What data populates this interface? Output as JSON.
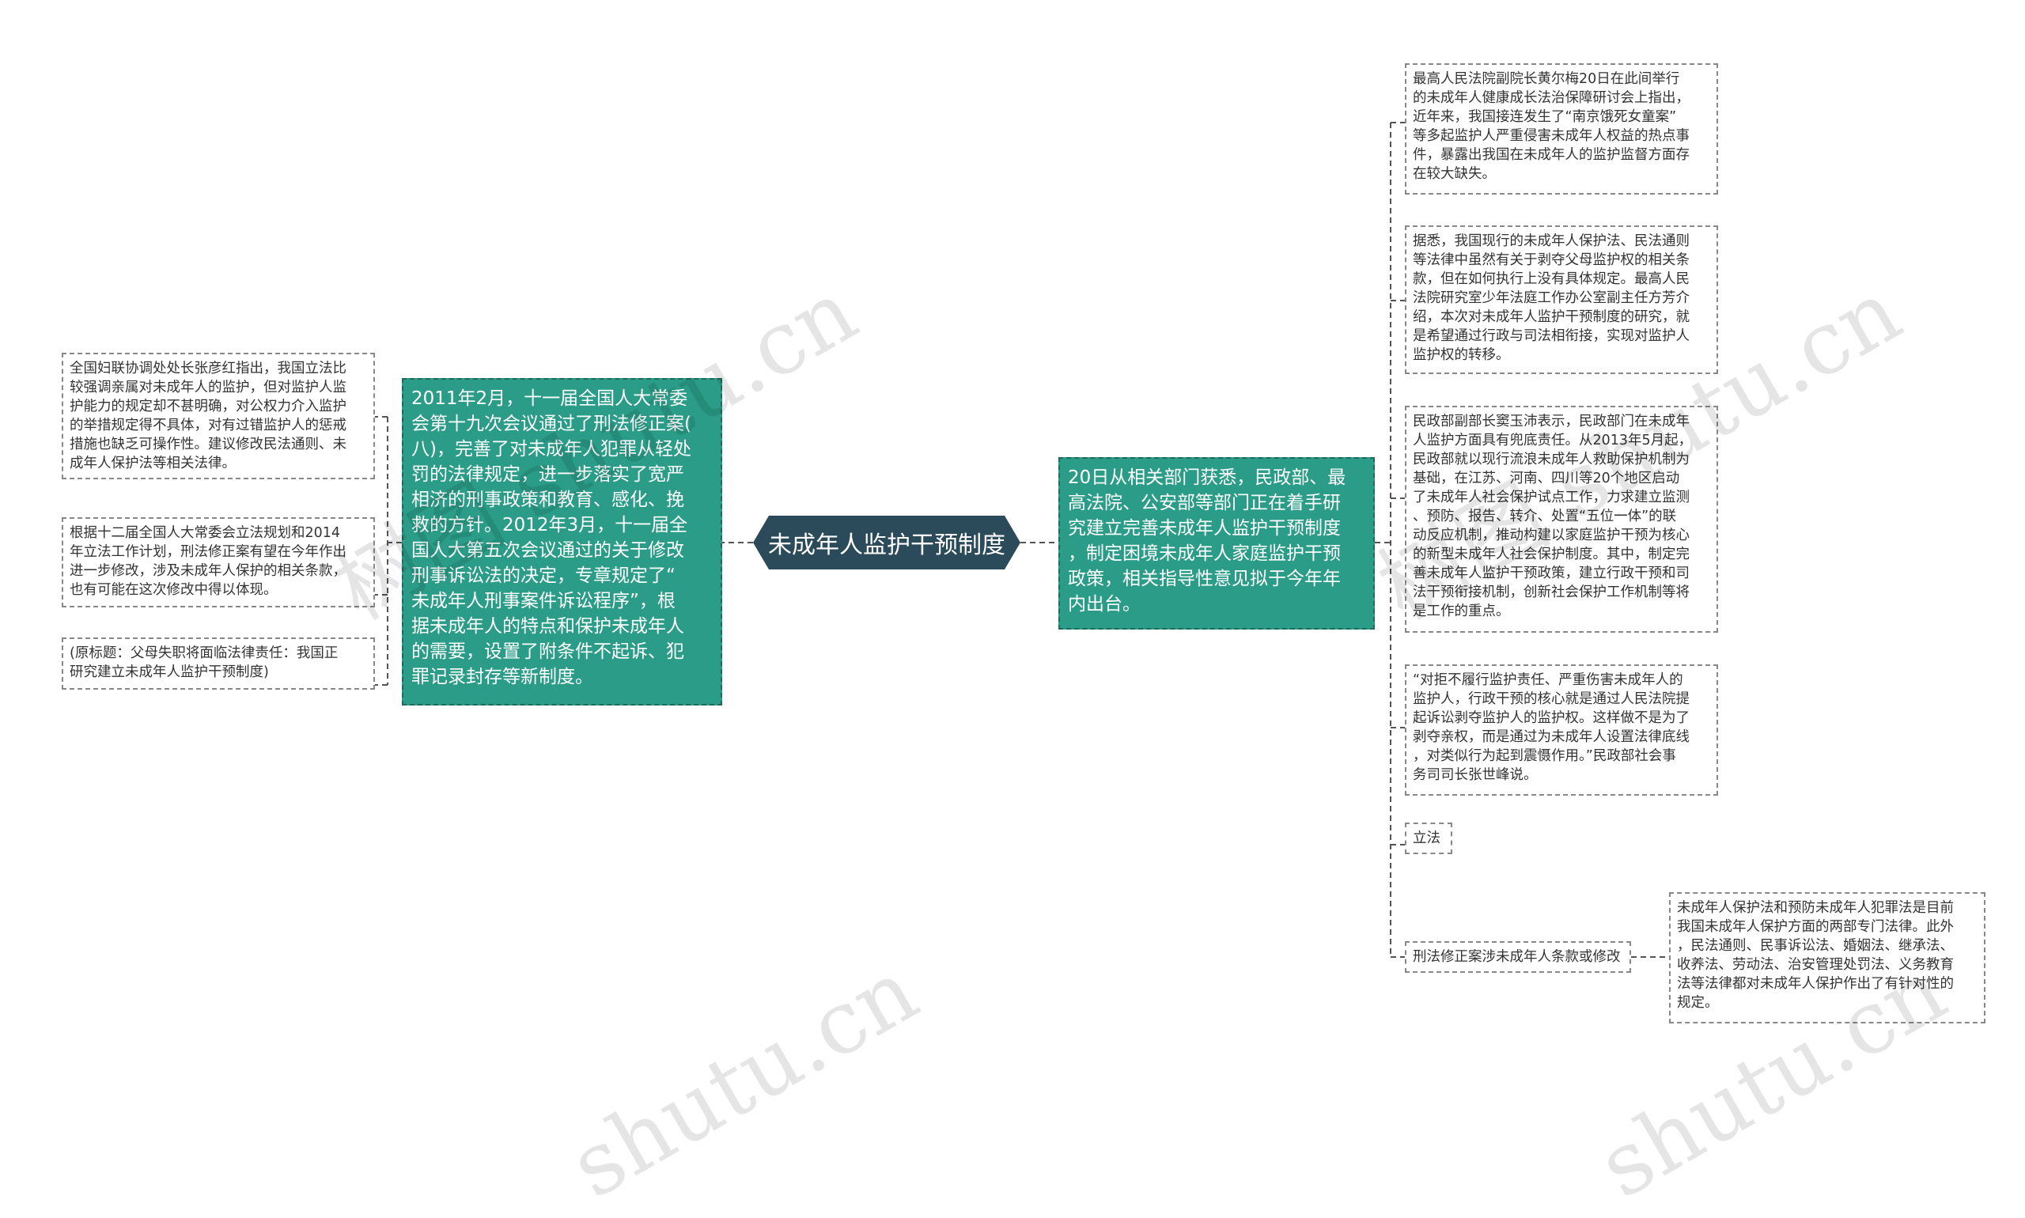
{
  "center": {
    "label": "未成年人监护干预制度"
  },
  "left_branch": {
    "main": "2011年2月，十一届全国人大常委\n会第十九次会议通过了刑法修正案(\n八)，完善了对未成年人犯罪从轻处\n罚的法律规定，进一步落实了宽严\n相济的刑事政策和教育、感化、挽\n救的方针。2012年3月，十一届全\n国人大第五次会议通过的关于修改\n刑事诉讼法的决定，专章规定了“\n未成年人刑事案件诉讼程序”，根\n据未成年人的特点和保护未成年人\n的需要，设置了附条件不起诉、犯\n罪记录封存等新制度。",
    "leaves": [
      "全国妇联协调处处长张彦红指出，我国立法比\n较强调亲属对未成年人的监护，但对监护人监\n护能力的规定却不甚明确，对公权力介入监护\n的举措规定得不具体，对有过错监护人的惩戒\n措施也缺乏可操作性。建议修改民法通则、未\n成年人保护法等相关法律。",
      "根据十二届全国人大常委会立法规划和2014\n年立法工作计划，刑法修正案有望在今年作出\n进一步修改，涉及未成年人保护的相关条款，\n也有可能在这次修改中得以体现。",
      "(原标题：父母失职将面临法律责任：我国正\n研究建立未成年人监护干预制度)"
    ]
  },
  "right_branch": {
    "main": "20日从相关部门获悉，民政部、最\n高法院、公安部等部门正在着手研\n究建立完善未成年人监护干预制度\n，制定困境未成年人家庭监护干预\n政策，相关指导性意见拟于今年年\n内出台。",
    "leaves": [
      "最高人民法院副院长黄尔梅20日在此间举行\n的未成年人健康成长法治保障研讨会上指出，\n近年来，我国接连发生了“南京饿死女童案”\n等多起监护人严重侵害未成年人权益的热点事\n件，暴露出我国在未成年人的监护监督方面存\n在较大缺失。",
      "据悉，我国现行的未成年人保护法、民法通则\n等法律中虽然有关于剥夺父母监护权的相关条\n款，但在如何执行上没有具体规定。最高人民\n法院研究室少年法庭工作办公室副主任方芳介\n绍，本次对未成年人监护干预制度的研究，就\n是希望通过行政与司法相衔接，实现对监护人\n监护权的转移。",
      "民政部副部长窦玉沛表示，民政部门在未成年\n人监护方面具有兜底责任。从2013年5月起，\n民政部就以现行流浪未成年人救助保护机制为\n基础，在江苏、河南、四川等20个地区启动\n了未成年人社会保护试点工作，力求建立监测\n、预防、报告、转介、处置“五位一体”的联\n动反应机制，推动构建以家庭监护干预为核心\n的新型未成年人社会保护制度。其中，制定完\n善未成年人监护干预政策，建立行政干预和司\n法干预衔接机制，创新社会保护工作机制等将\n是工作的重点。",
      "“对拒不履行监护责任、严重伤害未成年人的\n监护人，行政干预的核心就是通过人民法院提\n起诉讼剥夺监护人的监护权。这样做不是为了\n剥夺亲权，而是通过为未成年人设置法律底线\n，对类似行为起到震慑作用。”民政部社会事\n务司司长张世峰说。",
      "立法",
      "刑法修正案涉未成年人条款或修改"
    ],
    "sub_leaf": "未成年人保护法和预防未成年人犯罪法是目前\n我国未成年人保护方面的两部专门法律。此外\n，民法通则、民事诉讼法、婚姻法、继承法、\n收养法、劳动法、治安管理处罚法、义务教育\n法等法律都对未成年人保护作出了有针对性的\n规定。"
  },
  "watermarks": [
    "树图 shutu.cn",
    "树图 shutu.cn",
    "shutu.cn",
    "shutu.cn"
  ]
}
